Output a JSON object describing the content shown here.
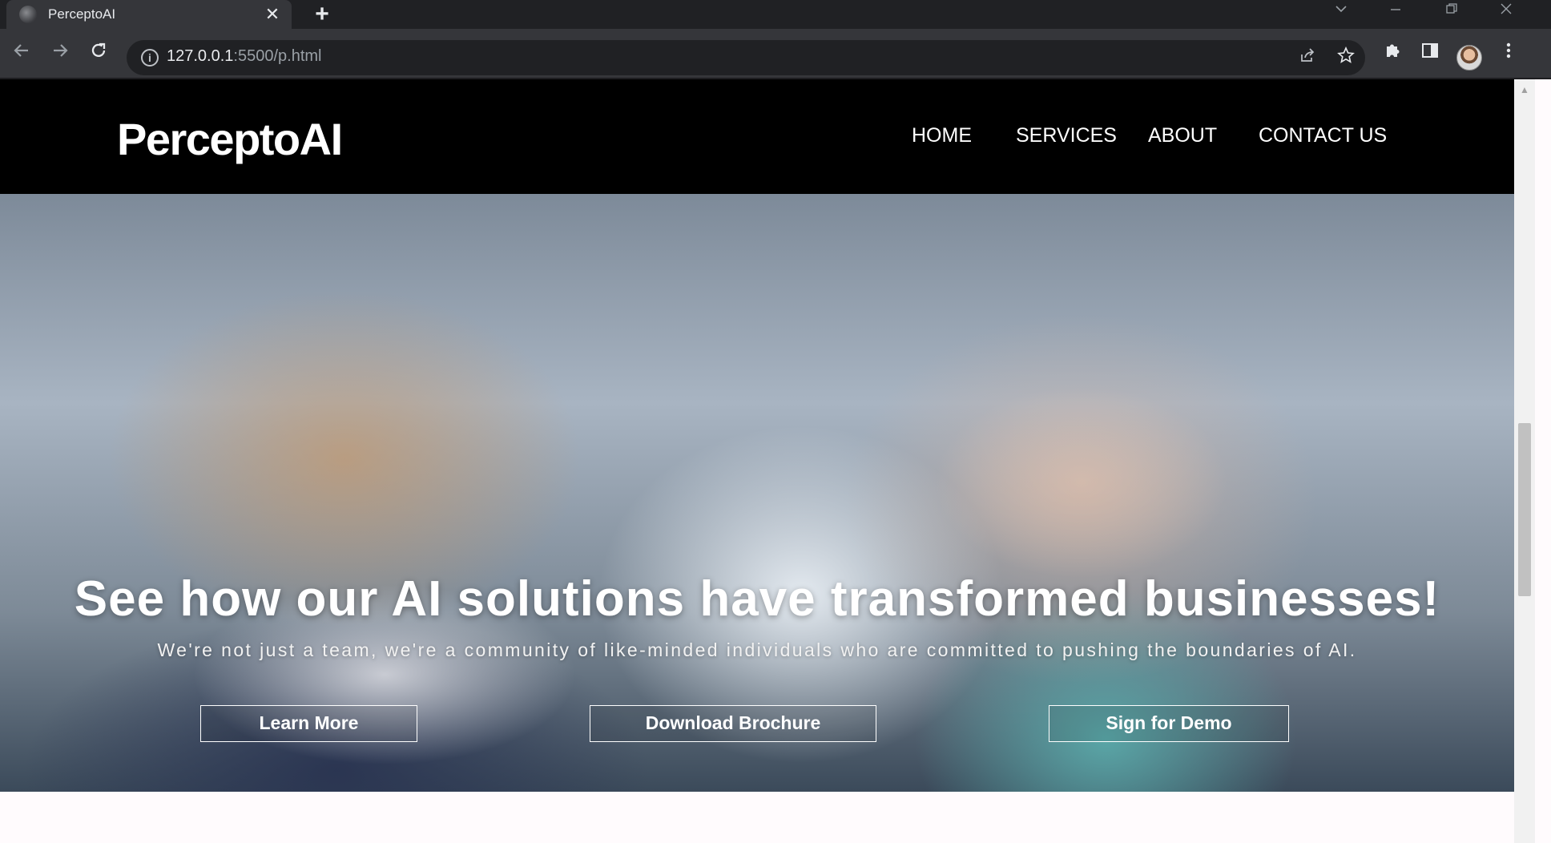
{
  "browser": {
    "tab_title": "PerceptoAI",
    "tab_close_glyph": "✕",
    "new_tab_glyph": "+",
    "url_host": "127.0.0.1",
    "url_rest": ":5500/p.html",
    "window_controls": [
      "chevron-down",
      "minimize",
      "restore",
      "close"
    ],
    "toolbar_icons": [
      "share-icon",
      "star-icon",
      "extensions-icon",
      "sidepanel-icon",
      "menu-icon"
    ]
  },
  "site": {
    "brand": "PerceptoAI",
    "nav": [
      "HOME",
      "SERVICES",
      "ABOUT",
      "CONTACT US"
    ]
  },
  "hero": {
    "title": "See how our AI solutions have transformed businesses!",
    "subtitle": "We're not just a team, we're a community of like-minded individuals who are committed to pushing the boundaries of AI.",
    "buttons": [
      "Learn More",
      "Download Brochure",
      "Sign for Demo"
    ]
  },
  "colors": {
    "header_bg": "#000000",
    "page_bg": "#fffbfd",
    "chrome_bg": "#35363a",
    "tabstrip_bg": "#202124"
  }
}
